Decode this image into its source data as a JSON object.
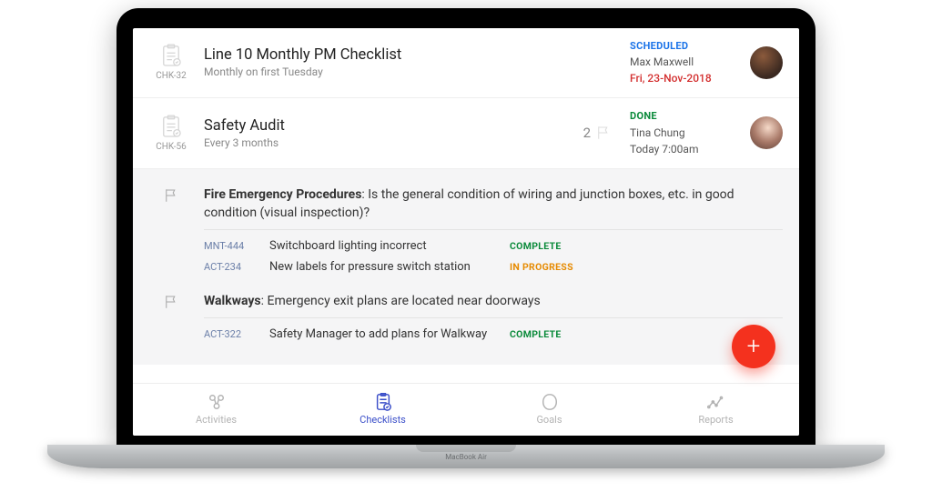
{
  "checklists": [
    {
      "id": "CHK-32",
      "title": "Line 10 Monthly PM Checklist",
      "schedule": "Monthly on first Tuesday",
      "status": "SCHEDULED",
      "status_class": "status-scheduled",
      "assignee": "Max Maxwell",
      "due": "Fri, 23-Nov-2018",
      "due_class": "due-red",
      "flag_count": null,
      "avatar_class": "av1"
    },
    {
      "id": "CHK-56",
      "title": "Safety Audit",
      "schedule": "Every 3 months",
      "status": "DONE",
      "status_class": "status-done",
      "assignee": "Tina Chung",
      "due": "Today 7:00am",
      "due_class": "due-normal",
      "flag_count": "2",
      "avatar_class": "av2"
    }
  ],
  "detail_items": [
    {
      "heading": "Fire Emergency Procedures",
      "question": ": Is the general condition of wiring and junction boxes, etc. in good condition (visual inspection)?",
      "actions": [
        {
          "id": "MNT-444",
          "title": "Switchboard lighting incorrect",
          "status": "COMPLETE",
          "pill_class": "pill-complete"
        },
        {
          "id": "ACT-234",
          "title": "New labels for pressure switch station",
          "status": "IN PROGRESS",
          "pill_class": "pill-progress"
        }
      ]
    },
    {
      "heading": "Walkways",
      "question": ": Emergency exit plans are located near doorways",
      "actions": [
        {
          "id": "ACT-322",
          "title": "Safety Manager to add plans for Walkway",
          "status": "COMPLETE",
          "pill_class": "pill-complete"
        }
      ]
    }
  ],
  "fab_label": "+",
  "nav": [
    {
      "key": "activities",
      "label": "Activities",
      "active": false
    },
    {
      "key": "checklists",
      "label": "Checklists",
      "active": true
    },
    {
      "key": "goals",
      "label": "Goals",
      "active": false
    },
    {
      "key": "reports",
      "label": "Reports",
      "active": false
    }
  ],
  "laptop_label": "MacBook Air"
}
